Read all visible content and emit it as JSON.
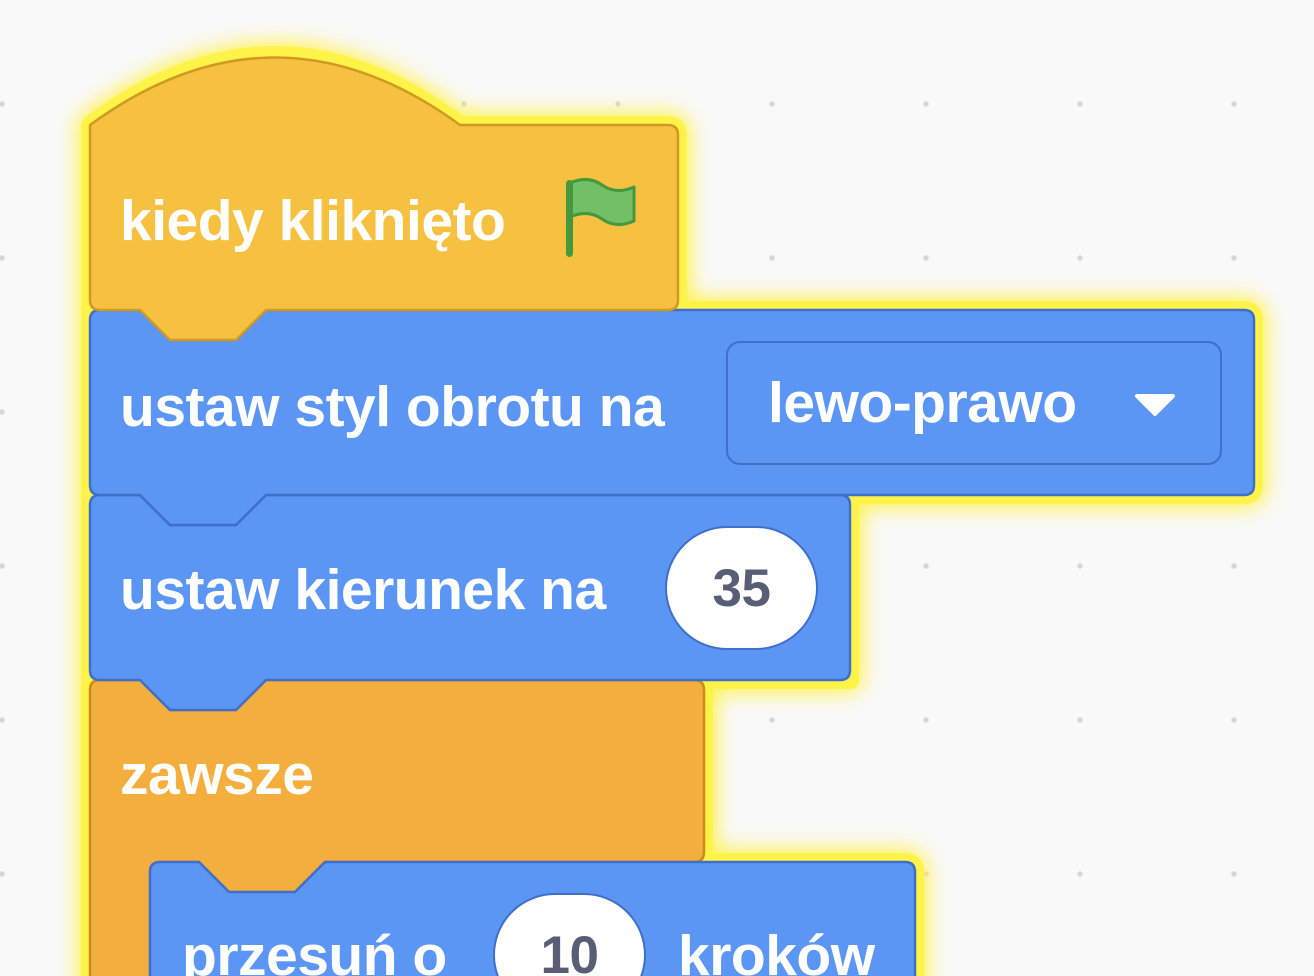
{
  "blocks": {
    "hat": {
      "label": "kiedy kliknięto",
      "icon": "green-flag-icon"
    },
    "rotation_style": {
      "label": "ustaw styl obrotu na",
      "value": "lewo-prawo"
    },
    "direction": {
      "label": "ustaw kierunek na",
      "value": "35"
    },
    "forever": {
      "label": "zawsze"
    },
    "move": {
      "label_before": "przesuń o",
      "value": "10",
      "label_after": "kroków"
    }
  },
  "colors": {
    "events": "#f6c141",
    "motion": "#5b96f5",
    "control": "#f4ae3e",
    "highlight": "#fff249",
    "flag": "#72bf66"
  }
}
